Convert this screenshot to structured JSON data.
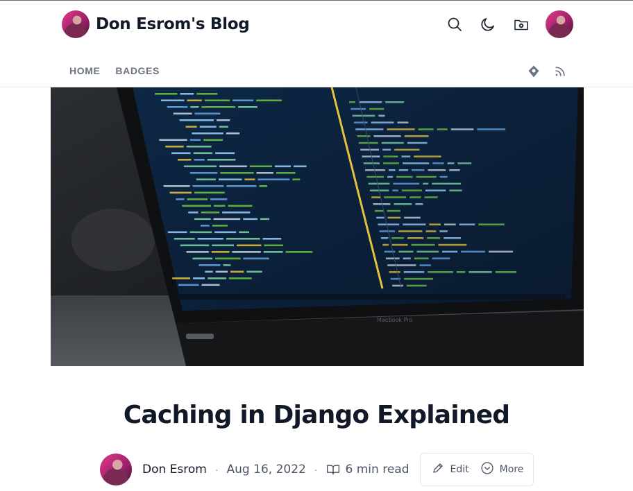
{
  "site": {
    "title": "Don Esrom's Blog",
    "header_icons": [
      "search-icon",
      "moon-icon",
      "folder-settings-icon",
      "avatar"
    ]
  },
  "nav": {
    "links": [
      "HOME",
      "BADGES"
    ],
    "icons": [
      "map-pin-icon",
      "rss-icon"
    ]
  },
  "post": {
    "title": "Caching in Django Explained",
    "author": "Don Esrom",
    "separator": "·",
    "date": "Aug 16, 2022",
    "read_time": "6 min read",
    "edit_label": "Edit",
    "more_label": "More"
  },
  "cover": {
    "device_label": "MacBook Pro"
  },
  "colors": {
    "text_dark": "#111827",
    "text_muted": "#6b7280",
    "border": "#e5e7eb",
    "code_green": "#6cc644",
    "code_yellow": "#e3c53d",
    "code_blue": "#6aa7e8"
  }
}
